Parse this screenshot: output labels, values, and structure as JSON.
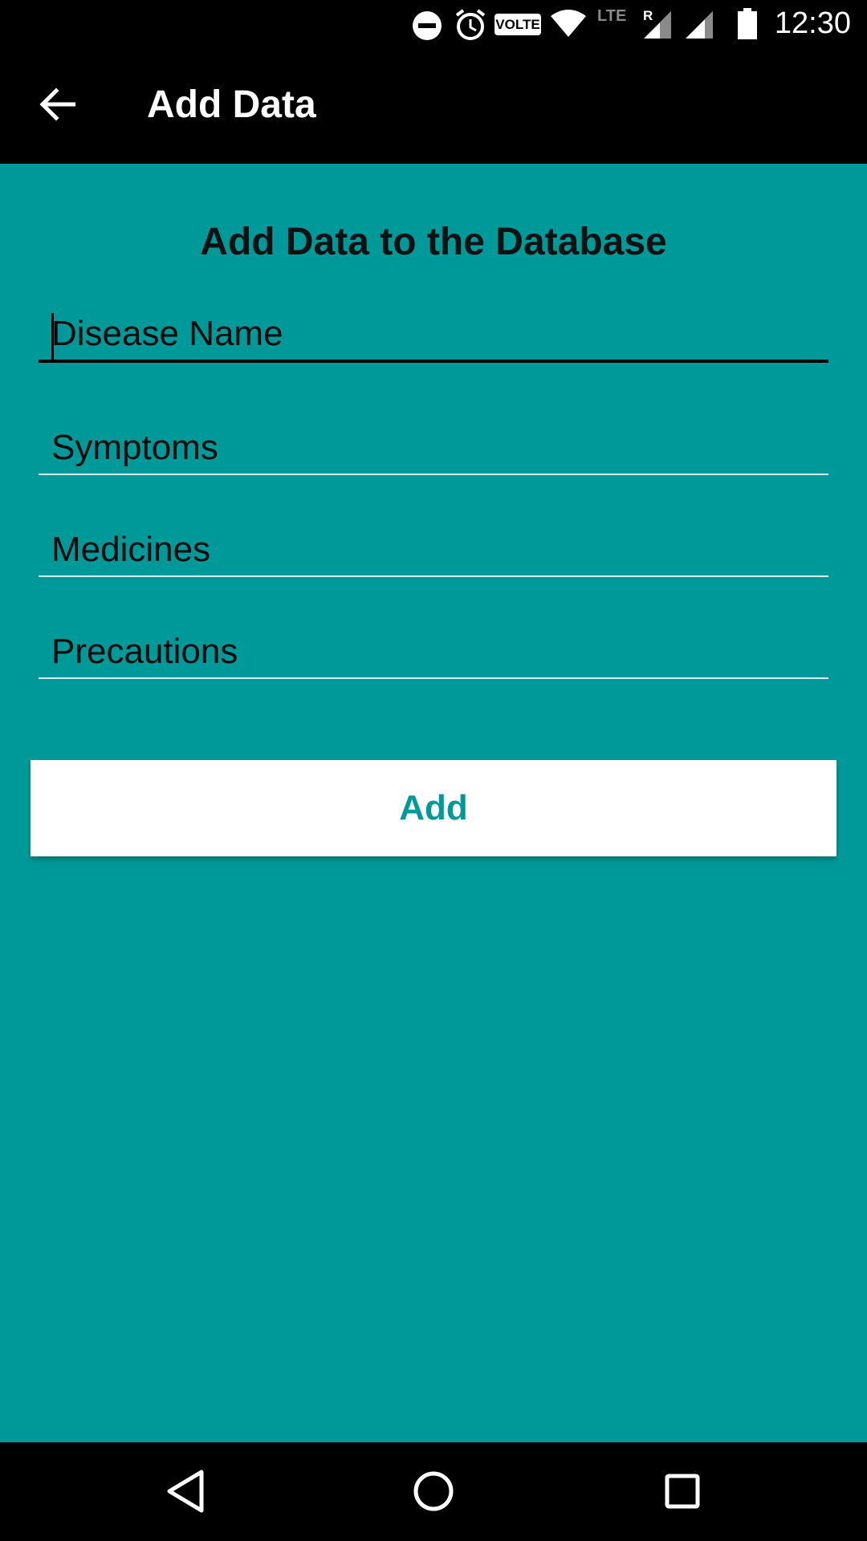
{
  "status_bar": {
    "time": "12:30",
    "volte": "VOLTE",
    "network": "LTE",
    "roaming": "R",
    "icons": [
      "dnd-icon",
      "alarm-icon",
      "volte-icon",
      "wifi-icon",
      "signal-icon",
      "signal-icon",
      "battery-icon"
    ]
  },
  "app_bar": {
    "title": "Add Data",
    "back_icon": "arrow-back-icon"
  },
  "form": {
    "heading": "Add Data to the Database",
    "fields": [
      {
        "placeholder": "Disease Name",
        "value": "",
        "focused": true
      },
      {
        "placeholder": "Symptoms",
        "value": ""
      },
      {
        "placeholder": "Medicines",
        "value": ""
      },
      {
        "placeholder": "Precautions",
        "value": ""
      }
    ],
    "submit_label": "Add"
  },
  "colors": {
    "background": "#009999",
    "app_bar": "#000000",
    "button_bg": "#ffffff",
    "button_text": "#009999"
  },
  "nav_bar": {
    "buttons": [
      "back-triangle-icon",
      "home-circle-icon",
      "recents-square-icon"
    ]
  }
}
